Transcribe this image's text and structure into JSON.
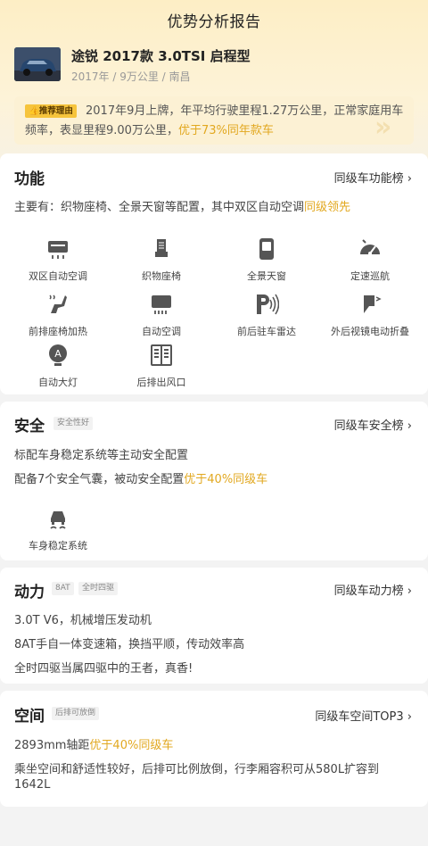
{
  "header": {
    "title": "优势分析报告"
  },
  "car": {
    "title": "途锐 2017款 3.0TSI 启程型",
    "meta": "2017年 / 9万公里 / 南昌"
  },
  "reason": {
    "tag": "推荐理由",
    "text_plain": "2017年9月上牌，年平均行驶里程1.27万公里，正常家庭用车频率，表显里程9.00万公里，",
    "text_highlight": "优于73%同年款车"
  },
  "function_card": {
    "title": "功能",
    "link": "同级车功能榜",
    "summary_plain": "主要有：织物座椅、全景天窗等配置，其中双区自动空调",
    "summary_highlight": "同级领先",
    "features": [
      {
        "label": "双区自动空调",
        "icon": "dual-zone-ac-icon"
      },
      {
        "label": "织物座椅",
        "icon": "fabric-seat-icon"
      },
      {
        "label": "全景天窗",
        "icon": "panoramic-sunroof-icon"
      },
      {
        "label": "定速巡航",
        "icon": "cruise-control-icon"
      },
      {
        "label": "前排座椅加热",
        "icon": "seat-heating-icon"
      },
      {
        "label": "自动空调",
        "icon": "auto-ac-icon"
      },
      {
        "label": "前后驻车雷达",
        "icon": "parking-radar-icon"
      },
      {
        "label": "外后视镜电动折叠",
        "icon": "mirror-fold-icon"
      },
      {
        "label": "自动大灯",
        "icon": "auto-headlight-icon"
      },
      {
        "label": "后排出风口",
        "icon": "rear-vent-icon"
      }
    ]
  },
  "safety_card": {
    "title": "安全",
    "badge": "安全性好",
    "link": "同级车安全榜",
    "line1": "标配车身稳定系统等主动安全配置",
    "line2_plain": "配备7个安全气囊，被动安全配置",
    "line2_highlight": "优于40%同级车",
    "feature_label": "车身稳定系统"
  },
  "power_card": {
    "title": "动力",
    "badge1": "8AT",
    "badge2": "全时四驱",
    "link": "同级车动力榜",
    "lines": [
      "3.0T V6，机械增压发动机",
      "8AT手自一体变速箱，换挡平顺，传动效率高",
      "全时四驱当属四驱中的王者，真香!"
    ]
  },
  "space_card": {
    "title": "空间",
    "badge": "后排可放倒",
    "link": "同级车空间TOP3",
    "line1_plain": "2893mm轴距",
    "line1_highlight": "优于40%同级车",
    "line2a": "乘坐空间和舒适性较好，后排可比例放倒，行李厢容积可从580L扩容到",
    "line2b": "1642L"
  },
  "colors": {
    "highlight": "#e2a820",
    "tag_bg": "#f6c43c",
    "top_bg": "#fdeec5"
  }
}
